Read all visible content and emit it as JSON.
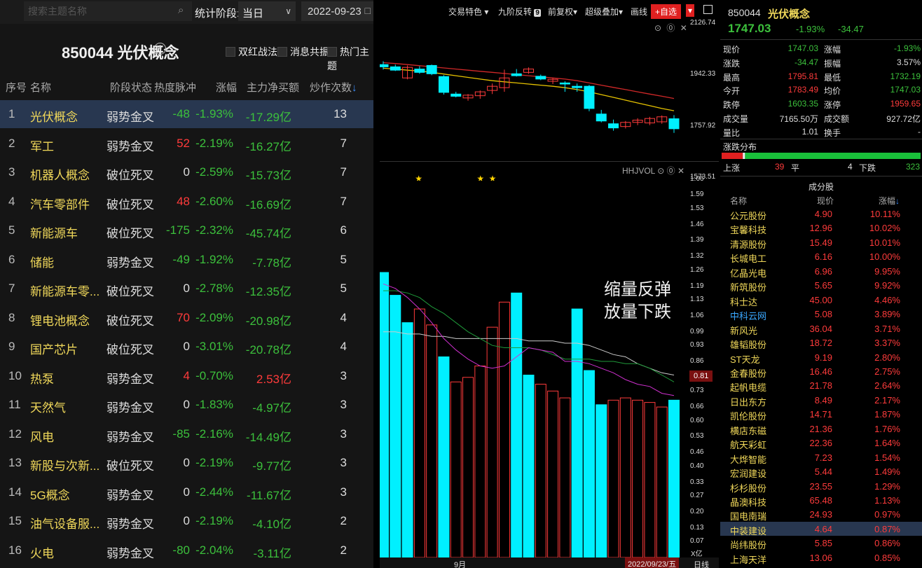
{
  "left": {
    "search_placeholder": "搜索主题名称",
    "stat_label": "统计阶段:",
    "stage_value": "当日",
    "date_value": "2022-09-23",
    "board_title": "850044 光伏概念",
    "checkboxes": [
      "双红战法",
      "消息共振",
      "热门主题"
    ],
    "columns": {
      "idx": "序号",
      "name": "名称",
      "state": "阶段状态",
      "heat": "热度脉冲",
      "chg": "涨幅",
      "net": "主力净买额",
      "cnt": "炒作次数",
      "sort_arrow": "↓"
    },
    "rows": [
      {
        "idx": "1",
        "name": "光伏概念",
        "state": "弱势金叉",
        "heat": "-48",
        "chg": "-1.93%",
        "net": "-17.29亿",
        "cnt": "13"
      },
      {
        "idx": "2",
        "name": "军工",
        "state": "弱势金叉",
        "heat": "52",
        "chg": "-2.19%",
        "net": "-16.27亿",
        "cnt": "7"
      },
      {
        "idx": "3",
        "name": "机器人概念",
        "state": "破位死叉",
        "heat": "0",
        "chg": "-2.59%",
        "net": "-15.73亿",
        "cnt": "7"
      },
      {
        "idx": "4",
        "name": "汽车零部件",
        "state": "破位死叉",
        "heat": "48",
        "chg": "-2.60%",
        "net": "-16.69亿",
        "cnt": "7"
      },
      {
        "idx": "5",
        "name": "新能源车",
        "state": "破位死叉",
        "heat": "-175",
        "chg": "-2.32%",
        "net": "-45.74亿",
        "cnt": "6"
      },
      {
        "idx": "6",
        "name": "储能",
        "state": "弱势金叉",
        "heat": "-49",
        "chg": "-1.92%",
        "net": "-7.78亿",
        "cnt": "5"
      },
      {
        "idx": "7",
        "name": "新能源车零...",
        "state": "破位死叉",
        "heat": "0",
        "chg": "-2.78%",
        "net": "-12.35亿",
        "cnt": "5"
      },
      {
        "idx": "8",
        "name": "锂电池概念",
        "state": "破位死叉",
        "heat": "70",
        "chg": "-2.09%",
        "net": "-20.98亿",
        "cnt": "4"
      },
      {
        "idx": "9",
        "name": "国产芯片",
        "state": "破位死叉",
        "heat": "0",
        "chg": "-3.01%",
        "net": "-20.78亿",
        "cnt": "4"
      },
      {
        "idx": "10",
        "name": "热泵",
        "state": "弱势金叉",
        "heat": "4",
        "chg": "-0.70%",
        "net": "2.53亿",
        "cnt": "3"
      },
      {
        "idx": "11",
        "name": "天然气",
        "state": "弱势金叉",
        "heat": "0",
        "chg": "-1.83%",
        "net": "-4.97亿",
        "cnt": "3"
      },
      {
        "idx": "12",
        "name": "风电",
        "state": "弱势金叉",
        "heat": "-85",
        "chg": "-2.16%",
        "net": "-14.49亿",
        "cnt": "3"
      },
      {
        "idx": "13",
        "name": "新股与次新...",
        "state": "破位死叉",
        "heat": "0",
        "chg": "-2.19%",
        "net": "-9.77亿",
        "cnt": "3"
      },
      {
        "idx": "14",
        "name": "5G概念",
        "state": "弱势金叉",
        "heat": "0",
        "chg": "-2.44%",
        "net": "-11.67亿",
        "cnt": "3"
      },
      {
        "idx": "15",
        "name": "油气设备服...",
        "state": "弱势金叉",
        "heat": "0",
        "chg": "-2.19%",
        "net": "-4.10亿",
        "cnt": "2"
      },
      {
        "idx": "16",
        "name": "火电",
        "state": "弱势金叉",
        "heat": "-80",
        "chg": "-2.04%",
        "net": "-3.11亿",
        "cnt": "2"
      }
    ]
  },
  "center": {
    "toolbar": {
      "trade_feature": "交易特色 ▾",
      "nine_turn": "九阶反转",
      "nine_badge": "9",
      "rights": "前复权▾",
      "overlay": "超级叠加▾",
      "draw": "画线",
      "fav": "+自选",
      "fav_drop": "▾"
    },
    "price_ctrl": "⊙ ⓪ ✕",
    "vol_indicator": "HHJVOL",
    "vol_ctrl": "⊙ ⓪ ✕",
    "price_ticks": [
      "2126.74",
      "1942.33",
      "1757.92",
      "1573.51"
    ],
    "vol_ticks": [
      "1.66",
      "1.59",
      "1.53",
      "1.46",
      "1.39",
      "1.32",
      "1.26",
      "1.19",
      "1.13",
      "1.06",
      "0.99",
      "0.93",
      "0.86",
      "0.73",
      "0.66",
      "0.60",
      "0.53",
      "0.46",
      "0.40",
      "0.33",
      "0.27",
      "0.20",
      "0.13",
      "0.07"
    ],
    "vol_unit": "X亿",
    "current_vol": "0.81",
    "annotation_1": "缩量反弹",
    "annotation_2": "放量下跌",
    "month_label": "9月",
    "date_tag": "2022/09/23/五",
    "period_tag": "日线",
    "colors": {
      "up": "#ff3b3b",
      "down": "#00f0ff",
      "ma_yellow": "#e6c200",
      "ma_red": "#d02828",
      "vol_white": "#cccccc",
      "vol_green": "#1f9a3a",
      "vol_magenta": "#d030d0"
    }
  },
  "chart_data": [
    {
      "type": "candlestick",
      "y_axis_ticks": [
        2126.74,
        1942.33,
        1757.92,
        1573.51
      ],
      "ylim": [
        1560,
        2140
      ],
      "candles": [
        {
          "o": 1978,
          "h": 1990,
          "l": 1960,
          "c": 1970
        },
        {
          "o": 1970,
          "h": 1978,
          "l": 1955,
          "c": 1958
        },
        {
          "o": 1930,
          "h": 1975,
          "l": 1925,
          "c": 1968
        },
        {
          "o": 1962,
          "h": 1972,
          "l": 1945,
          "c": 1950
        },
        {
          "o": 1975,
          "h": 1978,
          "l": 1940,
          "c": 1945
        },
        {
          "o": 1935,
          "h": 1940,
          "l": 1870,
          "c": 1878
        },
        {
          "o": 1872,
          "h": 1880,
          "l": 1860,
          "c": 1864
        },
        {
          "o": 1858,
          "h": 1872,
          "l": 1848,
          "c": 1868
        },
        {
          "o": 1866,
          "h": 1885,
          "l": 1855,
          "c": 1880
        },
        {
          "o": 1885,
          "h": 1910,
          "l": 1872,
          "c": 1900
        },
        {
          "o": 1895,
          "h": 1960,
          "l": 1880,
          "c": 1930
        },
        {
          "o": 1945,
          "h": 1962,
          "l": 1935,
          "c": 1938
        },
        {
          "o": 1950,
          "h": 1968,
          "l": 1945,
          "c": 1962
        },
        {
          "o": 1936,
          "h": 1942,
          "l": 1922,
          "c": 1926
        },
        {
          "o": 1918,
          "h": 1930,
          "l": 1908,
          "c": 1925
        },
        {
          "o": 1912,
          "h": 1918,
          "l": 1880,
          "c": 1908
        },
        {
          "o": 1900,
          "h": 1910,
          "l": 1880,
          "c": 1895
        },
        {
          "o": 1900,
          "h": 1905,
          "l": 1810,
          "c": 1820
        },
        {
          "o": 1800,
          "h": 1815,
          "l": 1770,
          "c": 1775
        },
        {
          "o": 1765,
          "h": 1780,
          "l": 1740,
          "c": 1750
        },
        {
          "o": 1755,
          "h": 1775,
          "l": 1748,
          "c": 1770
        },
        {
          "o": 1770,
          "h": 1785,
          "l": 1760,
          "c": 1778
        },
        {
          "o": 1768,
          "h": 1790,
          "l": 1760,
          "c": 1784
        },
        {
          "o": 1772,
          "h": 1795,
          "l": 1765,
          "c": 1790
        },
        {
          "o": 1783,
          "h": 1796,
          "l": 1732,
          "c": 1747
        }
      ],
      "ma_yellow": [
        1965,
        1962,
        1958,
        1955,
        1950,
        1944,
        1938,
        1932,
        1926,
        1920,
        1916,
        1912,
        1908,
        1904,
        1900,
        1895,
        1888,
        1880,
        1870,
        1860,
        1850,
        1840,
        1830,
        1820,
        1812
      ],
      "ma_red": [
        1985,
        1982,
        1978,
        1974,
        1970,
        1966,
        1962,
        1958,
        1954,
        1950,
        1946,
        1942,
        1938,
        1934,
        1930,
        1926,
        1920,
        1912,
        1904,
        1896,
        1888,
        1880,
        1872,
        1864,
        1856
      ],
      "markers": [
        {
          "type": "star",
          "index": 1
        },
        {
          "type": "star",
          "index": 8
        },
        {
          "type": "star",
          "index": 9
        }
      ]
    },
    {
      "type": "bar",
      "unit": "亿",
      "ylim": [
        0.0,
        1.72
      ],
      "values": [
        1.25,
        1.15,
        1.03,
        1.09,
        1.02,
        0.88,
        0.77,
        0.79,
        0.84,
        1.01,
        1.12,
        1.16,
        0.8,
        0.76,
        0.73,
        0.7,
        1.09,
        0.82,
        0.67,
        0.69,
        0.7,
        0.69,
        0.68,
        0.66,
        0.69
      ],
      "up": [
        false,
        false,
        false,
        true,
        true,
        false,
        true,
        true,
        true,
        true,
        true,
        false,
        false,
        true,
        true,
        true,
        false,
        false,
        false,
        true,
        true,
        true,
        true,
        true,
        false
      ],
      "lines": {
        "white": [
          0.99,
          0.99,
          0.98,
          0.98,
          0.97,
          0.97,
          0.96,
          0.96,
          0.96,
          0.96,
          0.96,
          0.96,
          0.95,
          0.95,
          0.95,
          0.94,
          0.94,
          0.93,
          0.91,
          0.89,
          0.88,
          0.85,
          0.83,
          0.81,
          0.8
        ],
        "green": [
          1.17,
          1.17,
          1.16,
          1.14,
          1.1,
          1.07,
          1.03,
          0.99,
          0.96,
          0.93,
          0.92,
          0.92,
          0.92,
          0.91,
          0.89,
          0.87,
          0.87,
          0.87,
          0.86,
          0.86,
          0.85,
          0.85,
          0.83,
          0.8,
          0.77
        ],
        "magenta": [
          1.2,
          1.18,
          1.14,
          1.09,
          1.03,
          0.96,
          0.91,
          0.87,
          0.84,
          0.83,
          0.84,
          0.88,
          0.92,
          0.91,
          0.9,
          0.86,
          0.86,
          0.85,
          0.83,
          0.81,
          0.78,
          0.76,
          0.75,
          0.72,
          0.71
        ]
      }
    }
  ],
  "right": {
    "code": "850044",
    "name": "光伏概念",
    "price": "1747.03",
    "pct": "-1.93%",
    "chg": "-34.47",
    "quotes": [
      {
        "l1": "现价",
        "v1": "1747.03",
        "c1": "down",
        "l2": "涨幅",
        "v2": "-1.93%",
        "c2": "down"
      },
      {
        "l1": "涨跌",
        "v1": "-34.47",
        "c1": "down",
        "l2": "振幅",
        "v2": "3.57%",
        "c2": "zero"
      },
      {
        "l1": "最高",
        "v1": "1795.81",
        "c1": "up",
        "l2": "最低",
        "v2": "1732.19",
        "c2": "down"
      },
      {
        "l1": "今开",
        "v1": "1783.49",
        "c1": "up",
        "l2": "均价",
        "v2": "1747.03",
        "c2": "down"
      },
      {
        "l1": "跌停",
        "v1": "1603.35",
        "c1": "down",
        "l2": "涨停",
        "v2": "1959.65",
        "c2": "up"
      },
      {
        "l1": "成交量",
        "v1": "7165.50万",
        "c1": "zero",
        "l2": "成交额",
        "v2": "927.72亿",
        "c2": "zero"
      },
      {
        "l1": "量比",
        "v1": "1.01",
        "c1": "zero",
        "l2": "换手",
        "v2": "-",
        "c2": "zero"
      }
    ],
    "dist": {
      "title": "涨跌分布",
      "up_label": "上涨",
      "up_count": "39",
      "flat_label": "平",
      "flat_count": "4",
      "down_label": "下跌",
      "down_count": "323"
    },
    "components": {
      "title": "成分股",
      "header": {
        "name": "名称",
        "price": "现价",
        "chg": "涨幅",
        "arrow": "↓"
      },
      "rows": [
        {
          "name": "公元股份",
          "price": "4.90",
          "chg": "10.11%"
        },
        {
          "name": "宝馨科技",
          "price": "12.96",
          "chg": "10.02%"
        },
        {
          "name": "清源股份",
          "price": "15.49",
          "chg": "10.01%"
        },
        {
          "name": "长城电工",
          "price": "6.16",
          "chg": "10.00%"
        },
        {
          "name": "亿晶光电",
          "price": "6.96",
          "chg": "9.95%"
        },
        {
          "name": "新筑股份",
          "price": "5.65",
          "chg": "9.92%"
        },
        {
          "name": "科士达",
          "price": "45.00",
          "chg": "4.46%"
        },
        {
          "name": "中科云网",
          "price": "5.08",
          "chg": "3.89%"
        },
        {
          "name": "新风光",
          "price": "36.04",
          "chg": "3.71%"
        },
        {
          "name": "雄韬股份",
          "price": "18.72",
          "chg": "3.37%"
        },
        {
          "name": "ST天龙",
          "price": "9.19",
          "chg": "2.80%"
        },
        {
          "name": "金春股份",
          "price": "16.46",
          "chg": "2.75%"
        },
        {
          "name": "起帆电缆",
          "price": "21.78",
          "chg": "2.64%"
        },
        {
          "name": "日出东方",
          "price": "8.49",
          "chg": "2.17%"
        },
        {
          "name": "凯伦股份",
          "price": "14.71",
          "chg": "1.87%"
        },
        {
          "name": "横店东磁",
          "price": "21.36",
          "chg": "1.76%"
        },
        {
          "name": "航天彩虹",
          "price": "22.36",
          "chg": "1.64%"
        },
        {
          "name": "大烨智能",
          "price": "7.23",
          "chg": "1.54%"
        },
        {
          "name": "宏润建设",
          "price": "5.44",
          "chg": "1.49%"
        },
        {
          "name": "杉杉股份",
          "price": "23.55",
          "chg": "1.29%"
        },
        {
          "name": "晶澳科技",
          "price": "65.48",
          "chg": "1.13%"
        },
        {
          "name": "国电南瑞",
          "price": "24.93",
          "chg": "0.97%"
        },
        {
          "name": "中装建设",
          "price": "4.64",
          "chg": "0.87%"
        },
        {
          "name": "尚纬股份",
          "price": "5.85",
          "chg": "0.86%"
        },
        {
          "name": "上海天洋",
          "price": "13.06",
          "chg": "0.85%"
        }
      ]
    }
  }
}
